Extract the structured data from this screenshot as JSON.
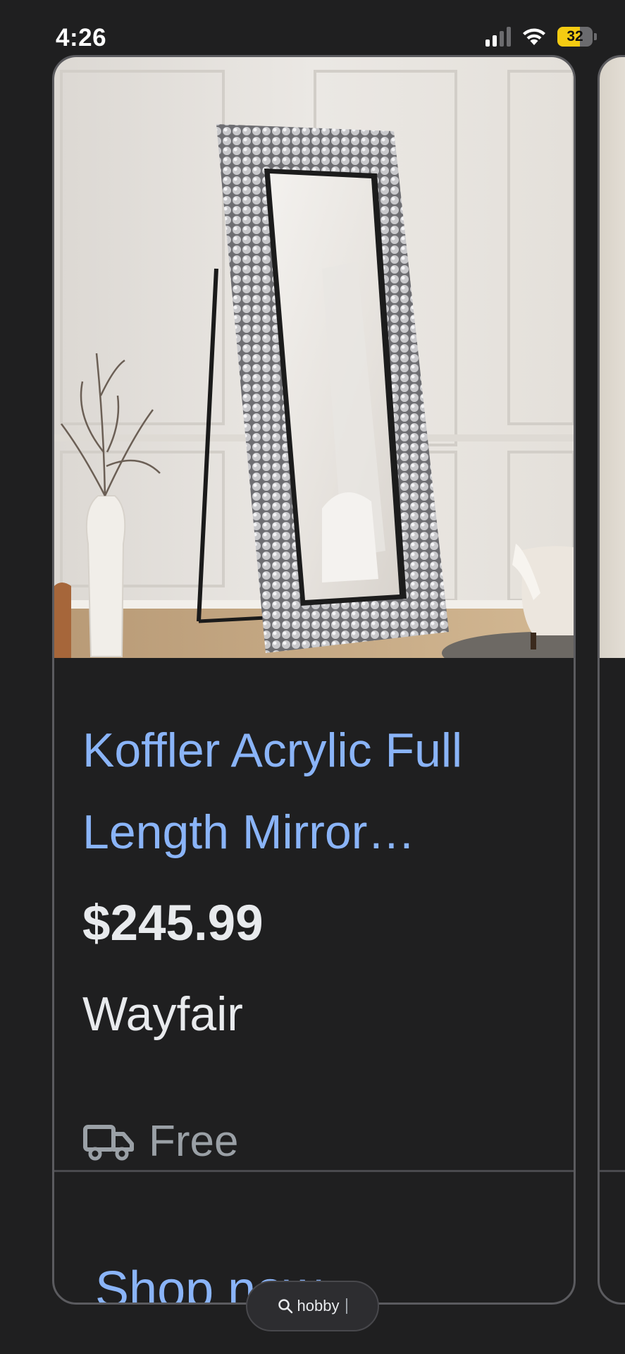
{
  "status_bar": {
    "time": "4:26",
    "battery_level": "32",
    "signal_bars_active": 2,
    "signal_bars_total": 4
  },
  "product_card": {
    "title": "Koffler Acrylic Full Length Mirror…",
    "price": "$245.99",
    "seller": "Wayfair",
    "shipping": "Free",
    "shipping_icon": "truck-icon",
    "cta_label": "Shop now"
  },
  "search_chip": {
    "query": "hobby",
    "icon": "search-icon"
  },
  "colors": {
    "background": "#1f1f20",
    "link": "#8ab4f8",
    "text": "#e8eaed",
    "muted": "#9aa0a6",
    "card_border": "#5b5b5f",
    "battery_fill": "#f4cb12"
  }
}
